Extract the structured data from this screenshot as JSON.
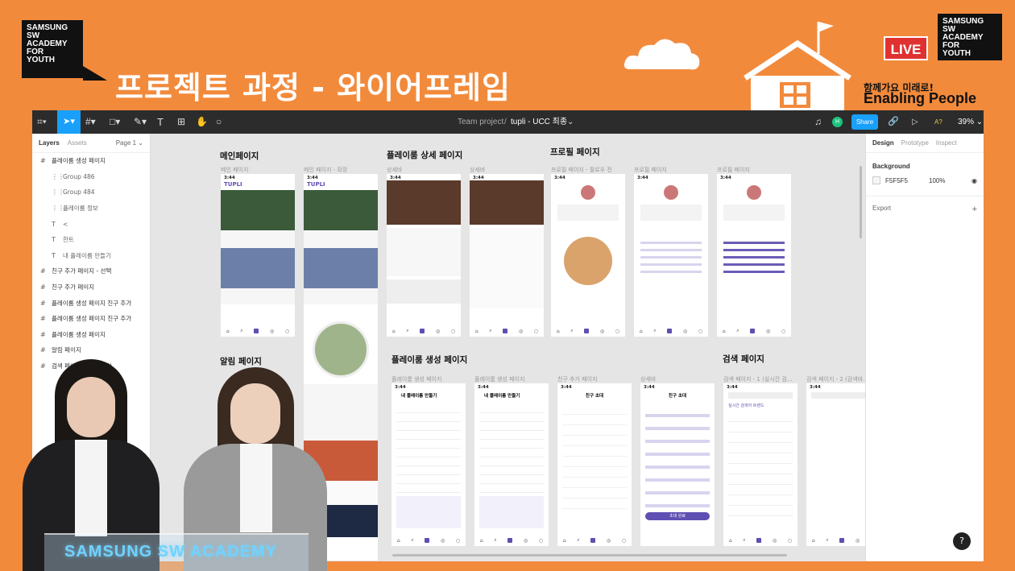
{
  "branding": {
    "logo_left": [
      "SAMSUNG",
      "SW",
      "ACADEMY",
      "FOR",
      "YOUTH"
    ],
    "logo_right": [
      "SAMSUNG",
      "SW",
      "ACADEMY",
      "FOR",
      "YOUTH"
    ],
    "live": "LIVE",
    "slogan_ko": "함께가요 미래로!",
    "slogan_en": "Enabling People",
    "banner": "SAMSUNG SW ACADEMY"
  },
  "slide_title": "프로젝트 과정 - 와이어프레임",
  "toolbar": {
    "breadcrumb_team": "Team project",
    "separator": "/",
    "file_name": "tupli - UCC 최종",
    "share": "Share",
    "avatar_initial": "H",
    "zoom": "39%",
    "text_tool": "T"
  },
  "layers_panel": {
    "tab_layers": "Layers",
    "tab_assets": "Assets",
    "page": "Page 1",
    "items": [
      {
        "label": "플레이룸 생성 페이지",
        "type": "frame"
      },
      {
        "label": "Group 486",
        "type": "group"
      },
      {
        "label": "Group 484",
        "type": "group"
      },
      {
        "label": "플레이룸 정보",
        "type": "group"
      },
      {
        "label": "<",
        "type": "text"
      },
      {
        "label": "한트",
        "type": "text"
      },
      {
        "label": "내 플레이룸 만들기",
        "type": "text"
      },
      {
        "label": "친구 추가 페이지 - 선택",
        "type": "frame"
      },
      {
        "label": "친구 추가 페이지",
        "type": "frame"
      },
      {
        "label": "플레이룸 생성 페이지 친구 추가",
        "type": "frame"
      },
      {
        "label": "플레이룸 생성 페이지 친구 추가",
        "type": "frame"
      },
      {
        "label": "플레이룸 생성 페이지",
        "type": "frame"
      },
      {
        "label": "알림 페이지",
        "type": "frame"
      },
      {
        "label": "검색 페이지 (검색 클릭)",
        "type": "frame"
      }
    ]
  },
  "design_panel": {
    "tabs": [
      "Design",
      "Prototype",
      "Inspect"
    ],
    "background_label": "Background",
    "bg_hex": "F5F5F5",
    "bg_opacity": "100%",
    "export_label": "Export",
    "add": "+"
  },
  "canvas": {
    "sections": {
      "main": "메인페이지",
      "detail": "플레이룸 상세 페이지",
      "profile": "프로필 페이지",
      "alarm": "알림 페이지",
      "create": "플레이룸 생성 페이지",
      "search": "검색 페이지"
    },
    "frame_labels": {
      "main1": "메인 페이지",
      "main2": "메인 페이지 - 확장",
      "detail1": "상세바",
      "detail2": "상세바",
      "profile1": "프로필 페이지 - 팔로우 전",
      "profile2": "프로필 페이지",
      "profile3": "프로필 페이지",
      "create1": "플레이룸 생성 페이지",
      "create2": "플레이룸 생성 페이지",
      "friend1": "친구 추가 페이지",
      "friend2": "상세바",
      "search1": "검색 페이지 - 1 (실시간 검...",
      "search2": "검색 페이지 - 2 (검색바..."
    },
    "phone_time": "3:44",
    "app_logo": "TUPLI",
    "create_title": "내 플레이룸 만들기",
    "friend_title": "친구 초대",
    "complete_btn": "초대 완료",
    "search_hint": "실시간 검색어 트렌드"
  },
  "colors": {
    "accent": "#5e4fb3",
    "figma_blue": "#18a0fb",
    "slide_bg": "#f28a3c"
  }
}
